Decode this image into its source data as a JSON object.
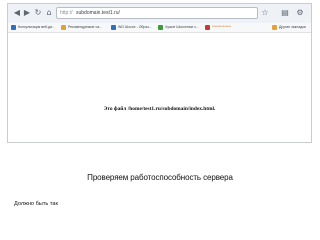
{
  "browser": {
    "address_prefix": "http://",
    "address_text": "subdomain.test1.ru/",
    "bookmarks": [
      {
        "label": "Консультация веб-ди...",
        "color": "#2f6fc0"
      },
      {
        "label": "Рекомендуемые са...",
        "color": "#e0a33a"
      },
      {
        "label": "WG Шоссе - Образ...",
        "color": "#2f6fc0"
      },
      {
        "label": "Чужое Шоссеные с...",
        "color": "#3f9a3f"
      },
      {
        "label": "**************",
        "color": "#c23a3a"
      },
      {
        "label": "Другие закладки",
        "color": "#e0a33a"
      }
    ],
    "page_text": "Это файл /home/test1.ru/subdomain/index.html."
  },
  "caption": "Проверяем работоспособность сервера",
  "note": "Должно быть так"
}
